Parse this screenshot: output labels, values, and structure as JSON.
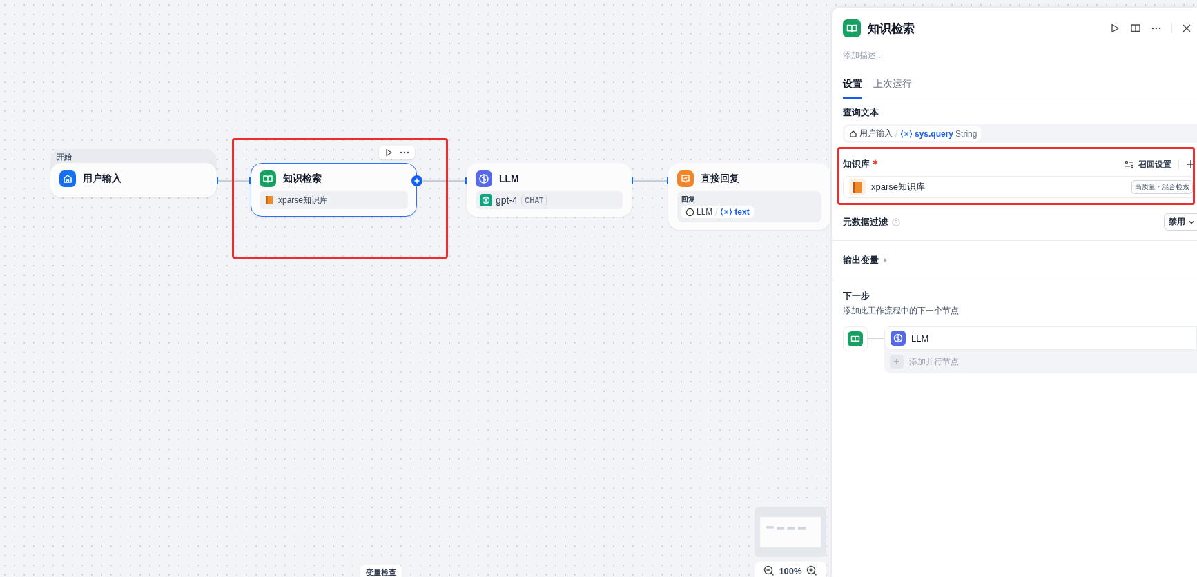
{
  "canvas": {
    "nodes": [
      {
        "kind": "start",
        "group_label": "开始",
        "title": "用户输入",
        "selected": false
      },
      {
        "kind": "knowledge",
        "title": "知识检索",
        "selected": true,
        "highlighted": true,
        "items": [
          "xparse知识库"
        ]
      },
      {
        "kind": "llm",
        "title": "LLM",
        "selected": false,
        "model": "gpt-4",
        "badge": "CHAT"
      },
      {
        "kind": "answer",
        "title": "直接回复",
        "selected": false,
        "field_label": "回复",
        "ref_node": "LLM",
        "ref_var": "text"
      }
    ],
    "variable_inspect": "变量检查",
    "zoom": "100%"
  },
  "panel": {
    "title": "知识检索",
    "description_placeholder": "添加描述...",
    "tabs": [
      {
        "label": "设置",
        "selected": true
      },
      {
        "label": "上次运行",
        "selected": false
      }
    ],
    "query": {
      "label": "查询文本",
      "source": "用户输入",
      "variable": "sys.query",
      "type": "String"
    },
    "knowledge": {
      "label": "知识库",
      "required": true,
      "highlighted": true,
      "recall_settings": "召回设置",
      "items": [
        {
          "name": "xparse知识库",
          "tag": "高质量 · 混合检索"
        }
      ]
    },
    "metadata_filter": {
      "label": "元数据过滤",
      "value": "禁用"
    },
    "output_vars": {
      "label": "输出变量",
      "expanded": false
    },
    "next_step": {
      "label": "下一步",
      "description": "添加此工作流程中的下一个节点",
      "nodes": [
        {
          "title": "LLM"
        }
      ],
      "add_parallel": "添加并行节点"
    }
  }
}
